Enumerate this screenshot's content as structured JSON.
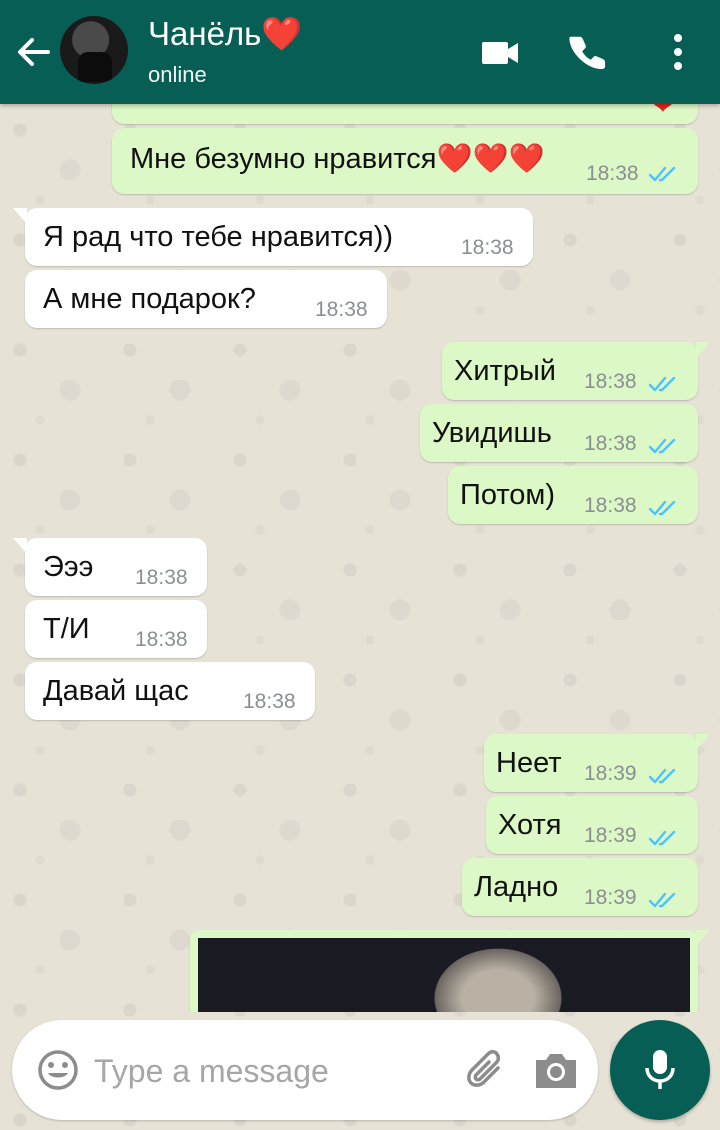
{
  "header": {
    "contact_name": "Чанёль❤️",
    "status": "online"
  },
  "messages": [
    {
      "dir": "out",
      "text": "Мне безумно нравится❤️❤️❤️",
      "time": "18:38",
      "ticks": "read"
    },
    {
      "dir": "in",
      "text": "Я рад что тебе нравится))",
      "time": "18:38"
    },
    {
      "dir": "in",
      "text": "А мне подарок?",
      "time": "18:38"
    },
    {
      "dir": "out",
      "text": "Хитрый",
      "time": "18:38",
      "ticks": "read"
    },
    {
      "dir": "out",
      "text": "Увидишь",
      "time": "18:38",
      "ticks": "read"
    },
    {
      "dir": "out",
      "text": "Потом)",
      "time": "18:38",
      "ticks": "read"
    },
    {
      "dir": "in",
      "text": "Эээ",
      "time": "18:38"
    },
    {
      "dir": "in",
      "text": "Т/И",
      "time": "18:38"
    },
    {
      "dir": "in",
      "text": "Давай щас",
      "time": "18:38"
    },
    {
      "dir": "out",
      "text": "Неет",
      "time": "18:39",
      "ticks": "read"
    },
    {
      "dir": "out",
      "text": "Хотя",
      "time": "18:39",
      "ticks": "read"
    },
    {
      "dir": "out",
      "text": "Ладно",
      "time": "18:39",
      "ticks": "read"
    }
  ],
  "composer": {
    "placeholder": "Type a message"
  },
  "colors": {
    "header": "#075e54",
    "outgoing_bubble": "#dcf8c6",
    "incoming_bubble": "#ffffff",
    "read_ticks": "#4fc3f7",
    "heart": "#e5241c"
  },
  "icons": [
    "back-arrow-icon",
    "video-camera-icon",
    "phone-icon",
    "more-vert-icon",
    "emoji-icon",
    "paperclip-icon",
    "camera-icon",
    "microphone-icon",
    "double-check-icon"
  ]
}
